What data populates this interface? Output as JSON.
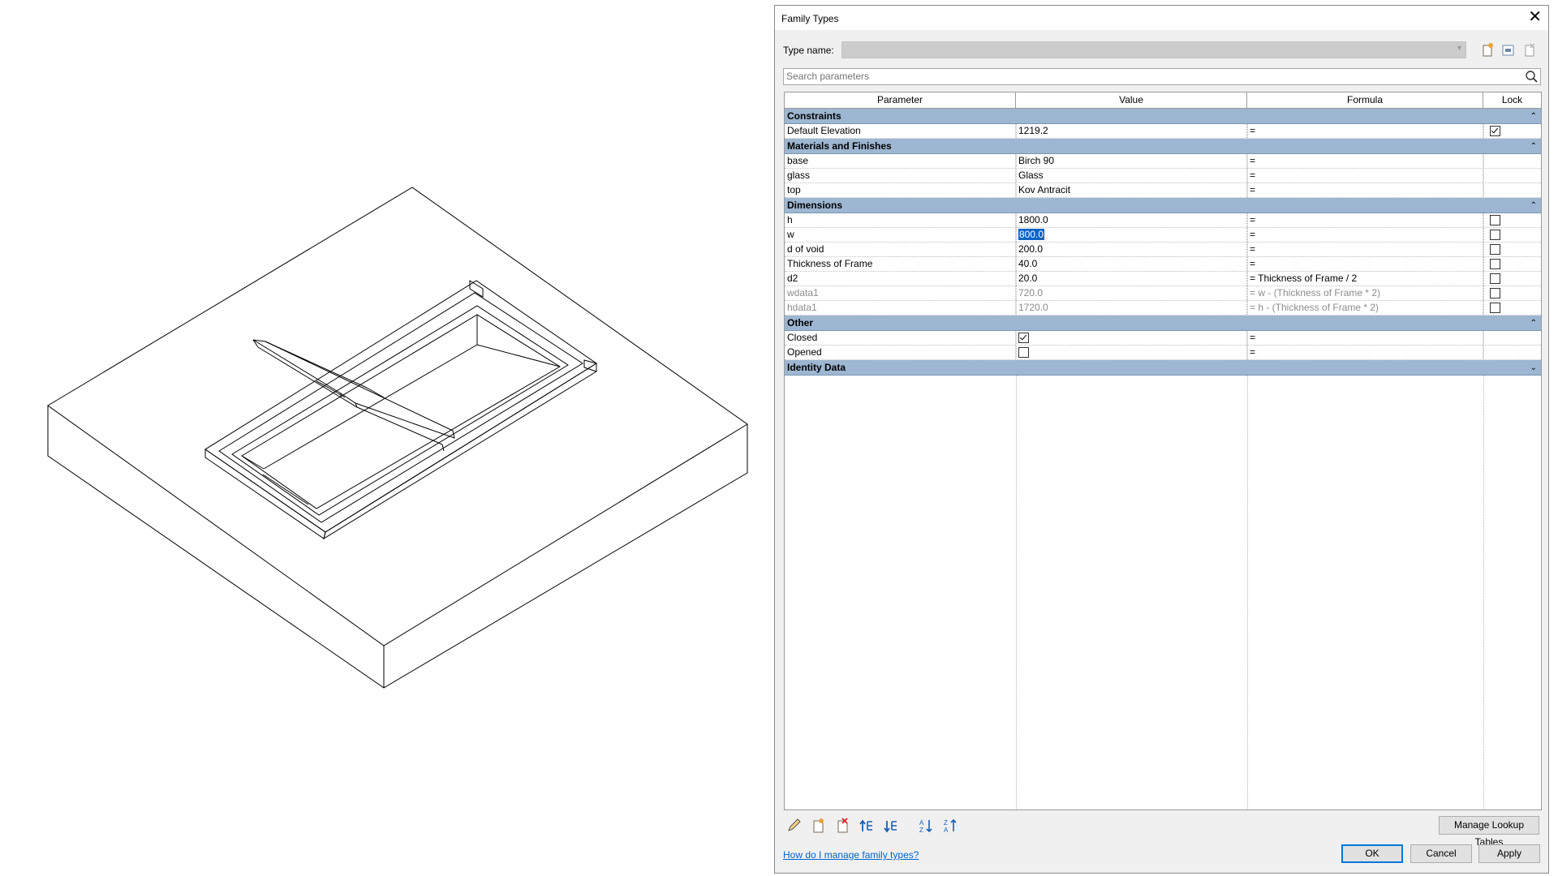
{
  "dialog": {
    "title": "Family Types",
    "type_name_label": "Type name:",
    "type_name_value": "",
    "search_placeholder": "Search parameters",
    "columns": [
      "Parameter",
      "Value",
      "Formula",
      "Lock"
    ],
    "groups": [
      {
        "name": "Constraints",
        "collapse_icon": "chevron-double-up-icon",
        "rows": [
          {
            "param": "Default Elevation",
            "value": "1219.2",
            "formula": "=",
            "lock": true
          }
        ]
      },
      {
        "name": "Materials and Finishes",
        "collapse_icon": "chevron-double-up-icon",
        "rows": [
          {
            "param": "base",
            "value": "Birch 90",
            "formula": "="
          },
          {
            "param": "glass",
            "value": "Glass",
            "formula": "="
          },
          {
            "param": "top",
            "value": "Kov Antracit",
            "formula": "="
          }
        ]
      },
      {
        "name": "Dimensions",
        "collapse_icon": "chevron-double-up-icon",
        "rows": [
          {
            "param": "h",
            "value": "1800.0",
            "formula": "=",
            "lock": false
          },
          {
            "param": "w",
            "value": "800.0",
            "formula": "=",
            "lock": false,
            "selected": true
          },
          {
            "param": "d of void",
            "value": "200.0",
            "formula": "=",
            "lock": false
          },
          {
            "param": "Thickness of Frame",
            "value": "40.0",
            "formula": "=",
            "lock": false
          },
          {
            "param": "d2",
            "value": "20.0",
            "formula": "= Thickness of Frame / 2",
            "lock": false
          },
          {
            "param": "wdata1",
            "value": "720.0",
            "formula": "= w - (Thickness of Frame * 2)",
            "lock": false,
            "readonly": true
          },
          {
            "param": "hdata1",
            "value": "1720.0",
            "formula": "= h - (Thickness of Frame * 2)",
            "lock": false,
            "readonly": true
          }
        ]
      },
      {
        "name": "Other",
        "collapse_icon": "chevron-double-up-icon",
        "rows": [
          {
            "param": "Closed",
            "checkbox": true,
            "formula": "="
          },
          {
            "param": "Opened",
            "checkbox": false,
            "formula": "="
          }
        ]
      },
      {
        "name": "Identity Data",
        "collapse_icon": "chevron-double-down-icon",
        "rows": []
      }
    ],
    "bottom_tools": [
      "edit-parameter-icon",
      "new-parameter-icon",
      "delete-parameter-icon",
      "move-up-icon",
      "move-down-icon",
      "sort-ascending-icon",
      "sort-descending-icon"
    ],
    "manage_lookup_label": "Manage Lookup Tables",
    "help_link": "How do I manage family types?",
    "ok_label": "OK",
    "cancel_label": "Cancel",
    "apply_label": "Apply"
  },
  "colors": {
    "group_header": "#9db6d1",
    "accent": "#0078d7",
    "selection": "#0a64c8",
    "link": "#0066cc"
  }
}
